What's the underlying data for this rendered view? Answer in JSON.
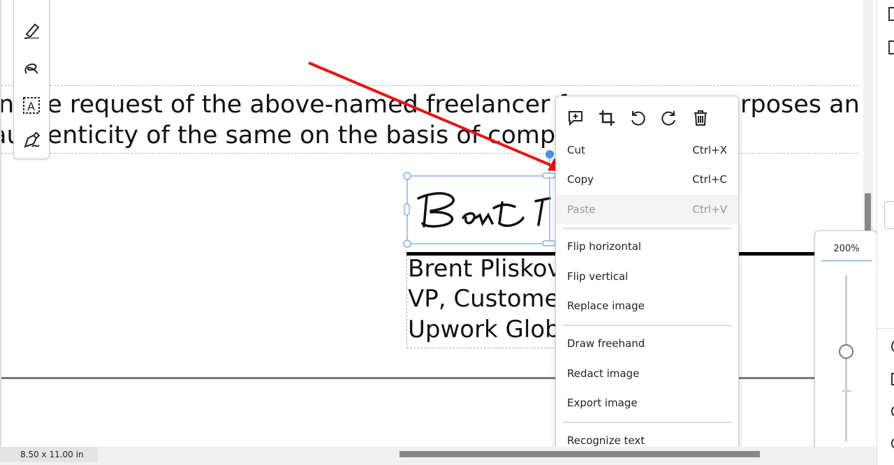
{
  "document": {
    "line1_left": "n the request of the above-named freelancer fo",
    "line1_right": "rposes and",
    "line2": "authenticity of the same on the basis of compa",
    "signer_lines": [
      "Brent Pliskov",
      "VP, Custome",
      "Upwork Glob"
    ]
  },
  "left_toolbar": {
    "icons": [
      "highlighter-icon",
      "freehand-draw-icon",
      "text-box-icon",
      "signature-pen-icon"
    ]
  },
  "context_menu": {
    "icons": [
      "add-comment-icon",
      "crop-icon",
      "rotate-left-icon",
      "rotate-right-icon",
      "delete-icon"
    ],
    "items": [
      {
        "label": "Cut",
        "shortcut": "Ctrl+X"
      },
      {
        "label": "Copy",
        "shortcut": "Ctrl+C"
      },
      {
        "label": "Paste",
        "shortcut": "Ctrl+V",
        "disabled": true
      },
      {
        "label": "Flip horizontal"
      },
      {
        "label": "Flip vertical"
      },
      {
        "label": "Replace image"
      },
      {
        "label": "Draw freehand"
      },
      {
        "label": "Redact image"
      },
      {
        "label": "Export image"
      },
      {
        "label": "Recognize text"
      }
    ]
  },
  "zoom": {
    "value": "200%",
    "accent": "#4a90e2"
  },
  "status_bar": {
    "page_size": "8.50 x 11.00 in"
  },
  "colors": {
    "annotation_arrow": "#ee1111",
    "selection": "#4a90e2"
  }
}
